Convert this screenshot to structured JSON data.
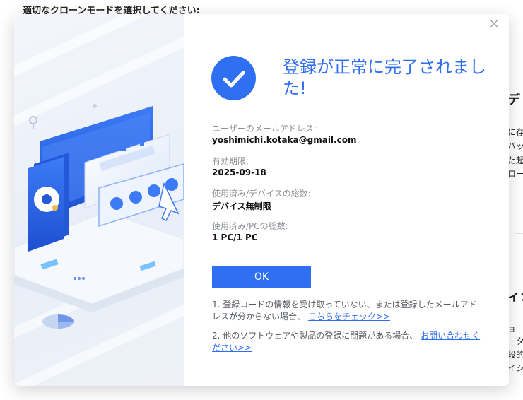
{
  "background": {
    "title": "適切なクローンモードを選択してください:",
    "right_heading_1": "デ",
    "right_lines_1": [
      "に存",
      "バッ",
      "た起",
      "ロー"
    ],
    "right_heading_2": "ィシ",
    "right_lines_2": [
      "ョ",
      "ータ",
      "段的",
      "イシ"
    ]
  },
  "dialog": {
    "close_icon": "×",
    "check_icon": "checkmark-icon",
    "title": "登録が正常に完了されました!",
    "fields": [
      {
        "label": "ユーザーのメールアドレス:",
        "value": "yoshimichi.kotaka@gmail.com"
      },
      {
        "label": "有効期限:",
        "value": "2025-09-18"
      },
      {
        "label": "使用済み/デバイスの総数:",
        "value": "デバイス無制限"
      },
      {
        "label": "使用済み/PCの総数:",
        "value": "1 PC/1 PC"
      }
    ],
    "ok_label": "OK",
    "note1_text": "1. 登録コードの情報を受け取っていない、または登録したメールアドレスが分からない場合、",
    "note1_link": "こちらをチェック>>",
    "note2_text": "2. 他のソフトウェアや製品の登録に問題がある場合、",
    "note2_link": "お問い合わせください>>"
  },
  "colors": {
    "accent": "#2f6ff2",
    "label_gray": "#8c9096"
  }
}
